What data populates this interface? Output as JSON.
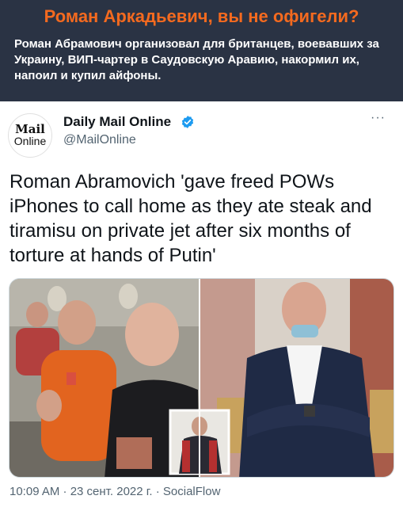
{
  "header": {
    "headline": "Роман Аркадьевич, вы не офигели?",
    "subtext": "Роман Абрамович организовал для британцев, воевавших за Украину, ВИП-чартер в Саудовскую Аравию, накормил их, напоил и купил айфоны."
  },
  "tweet": {
    "avatar_line1": "Mail",
    "avatar_line2": "Online",
    "author_name": "Daily Mail Online",
    "author_handle": "@MailOnline",
    "more_label": "···",
    "text": "Roman Abramovich 'gave freed POWs iPhones to call home as they ate steak and tiramisu on private jet after six months of torture at hands of Putin'",
    "timestamp": "10:09 AM · 23 сент. 2022 г. · SocialFlow"
  },
  "colors": {
    "header_bg": "#2a3344",
    "headline": "#f46a1f",
    "verified": "#1d9bf0"
  },
  "icons": {
    "verified": "verified-badge-icon",
    "more": "more-options-icon"
  }
}
